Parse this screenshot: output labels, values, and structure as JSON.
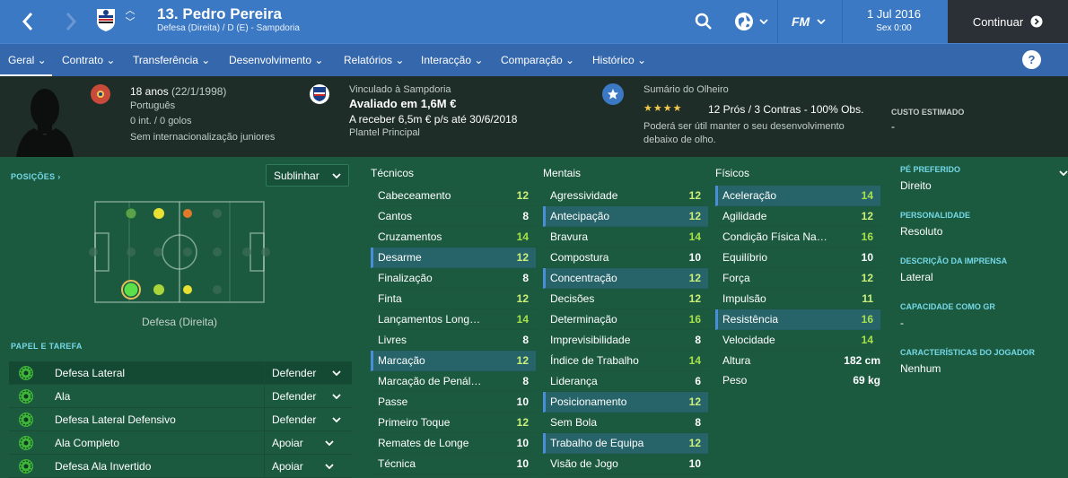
{
  "header": {
    "player_title": "13. Pedro Pereira",
    "player_sub": "Defesa (Direita) / D (E) - Sampdoria",
    "date": "1 Jul 2016",
    "time": "Sex 0:00",
    "continue_label": "Continuar",
    "fm_label": "FM"
  },
  "tabs": [
    {
      "label": "Geral"
    },
    {
      "label": "Contrato"
    },
    {
      "label": "Transferência"
    },
    {
      "label": "Desenvolvimento"
    },
    {
      "label": "Relatórios"
    },
    {
      "label": "Interacção"
    },
    {
      "label": "Comparação"
    },
    {
      "label": "Histórico"
    }
  ],
  "info": {
    "age": "18 anos",
    "dob": "(22/1/1998)",
    "nationality": "Português",
    "caps": "0 int. / 0 golos",
    "youth": "Sem internacionalização juniores",
    "club_label": "Vinculado à Sampdoria",
    "value": "Avaliado em 1,6M €",
    "wage": "A receber 6,5m € p/s até 30/6/2018",
    "squad": "Plantel Principal",
    "scout_label": "Sumário do Olheiro",
    "scout_stars": "★★★★",
    "scout_summary": "12 Prós / 3 Contras - 100% Obs.",
    "scout_text1": "Poderá ser útil manter o seu desenvolvimento",
    "scout_text2": "debaixo de olho.",
    "cost_label": "CUSTO ESTIMADO",
    "cost_value": "-"
  },
  "positions": {
    "label": "POSIÇÕES ›",
    "highlight_label": "Sublinhar",
    "position_name": "Defesa (Direita)"
  },
  "roles_label": "PAPEL E TAREFA",
  "roles": [
    {
      "name": "Defesa Lateral",
      "duty": "Defender"
    },
    {
      "name": "Ala",
      "duty": "Defender"
    },
    {
      "name": "Defesa Lateral Defensivo",
      "duty": "Defender"
    },
    {
      "name": "Ala Completo",
      "duty": "Apoiar"
    },
    {
      "name": "Defesa Ala Invertido",
      "duty": "Apoiar"
    }
  ],
  "attributes": {
    "technical_label": "Técnicos",
    "mental_label": "Mentais",
    "physical_label": "Físicos",
    "technical": [
      {
        "name": "Cabeceamento",
        "value": "12"
      },
      {
        "name": "Cantos",
        "value": "8"
      },
      {
        "name": "Cruzamentos",
        "value": "14"
      },
      {
        "name": "Desarme",
        "value": "12"
      },
      {
        "name": "Finalização",
        "value": "8"
      },
      {
        "name": "Finta",
        "value": "12"
      },
      {
        "name": "Lançamentos Long…",
        "value": "14"
      },
      {
        "name": "Livres",
        "value": "8"
      },
      {
        "name": "Marcação",
        "value": "12"
      },
      {
        "name": "Marcação de Penál…",
        "value": "8"
      },
      {
        "name": "Passe",
        "value": "10"
      },
      {
        "name": "Primeiro Toque",
        "value": "12"
      },
      {
        "name": "Remates de Longe",
        "value": "10"
      },
      {
        "name": "Técnica",
        "value": "10"
      }
    ],
    "mental": [
      {
        "name": "Agressividade",
        "value": "12"
      },
      {
        "name": "Antecipação",
        "value": "12"
      },
      {
        "name": "Bravura",
        "value": "14"
      },
      {
        "name": "Compostura",
        "value": "10"
      },
      {
        "name": "Concentração",
        "value": "12"
      },
      {
        "name": "Decisões",
        "value": "12"
      },
      {
        "name": "Determinação",
        "value": "16"
      },
      {
        "name": "Imprevisibilidade",
        "value": "8"
      },
      {
        "name": "Índice de Trabalho",
        "value": "14"
      },
      {
        "name": "Liderança",
        "value": "6"
      },
      {
        "name": "Posicionamento",
        "value": "12"
      },
      {
        "name": "Sem Bola",
        "value": "8"
      },
      {
        "name": "Trabalho de Equipa",
        "value": "12"
      },
      {
        "name": "Visão de Jogo",
        "value": "10"
      }
    ],
    "physical": [
      {
        "name": "Aceleração",
        "value": "14"
      },
      {
        "name": "Agilidade",
        "value": "12"
      },
      {
        "name": "Condição Física Na…",
        "value": "16"
      },
      {
        "name": "Equilíbrio",
        "value": "10"
      },
      {
        "name": "Força",
        "value": "12"
      },
      {
        "name": "Impulsão",
        "value": "11"
      },
      {
        "name": "Resistência",
        "value": "16"
      },
      {
        "name": "Velocidade",
        "value": "14"
      }
    ],
    "height_label": "Altura",
    "height_value": "182 cm",
    "weight_label": "Peso",
    "weight_value": "69 kg"
  },
  "right_panel": {
    "foot_label": "PÉ PREFERIDO",
    "foot_value": "Direito",
    "personality_label": "PERSONALIDADE",
    "personality_value": "Resoluto",
    "press_label": "DESCRIÇÃO DA IMPRENSA",
    "press_value": "Lateral",
    "gk_label": "CAPACIDADE COMO GR",
    "gk_value": "-",
    "traits_label": "CARACTERÍSTICAS DO JOGADOR",
    "traits_value": "Nenhum"
  },
  "colors": {
    "topbar": "#3b79c4",
    "tabbar": "#3567ac",
    "pitch_bg": "#1c5a40",
    "good_value": "#a6e04a",
    "highlight_row": "#3a79c4"
  }
}
